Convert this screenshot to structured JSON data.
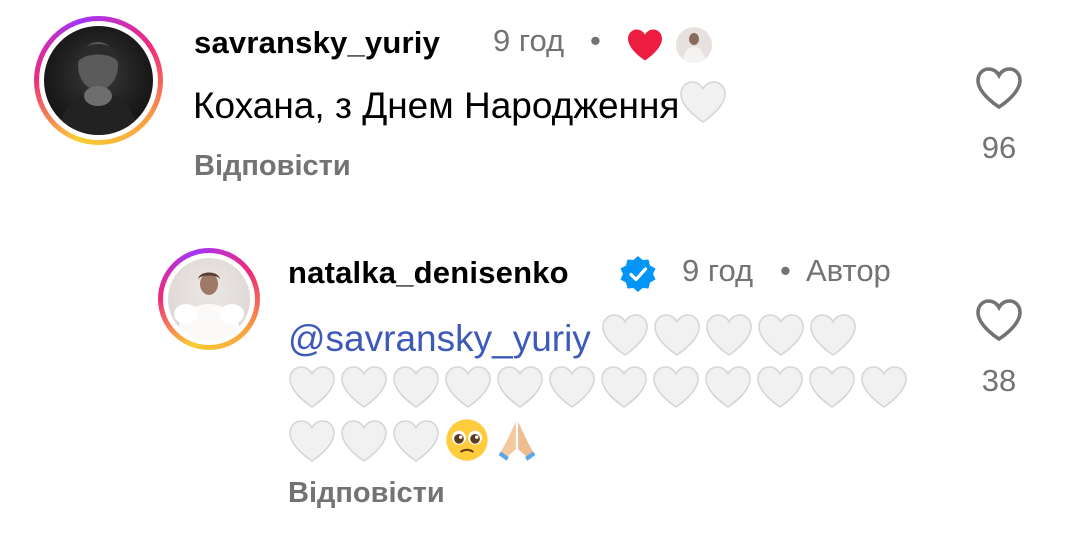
{
  "comment1": {
    "username": "savransky_yuriy",
    "time": "9 год",
    "separator": "•",
    "text": "Кохана, з Днем Народження",
    "reply_label": "Відповісти",
    "like_count": "96"
  },
  "comment2": {
    "username": "natalka_denisenko",
    "time": "9 год",
    "separator": "•",
    "author_label": "Автор",
    "mention": "@savransky_yuriy",
    "reply_label": "Відповісти",
    "like_count": "38"
  },
  "colors": {
    "accent_red": "#ed1d3f",
    "link_blue": "#3e5ab8",
    "muted": "#737373",
    "verified": "#0095f6"
  },
  "icons": [
    "heart-outline-icon",
    "red-heart-icon",
    "verified-badge-icon",
    "white-heart-emoji",
    "pleading-face-emoji",
    "folded-hands-emoji"
  ]
}
